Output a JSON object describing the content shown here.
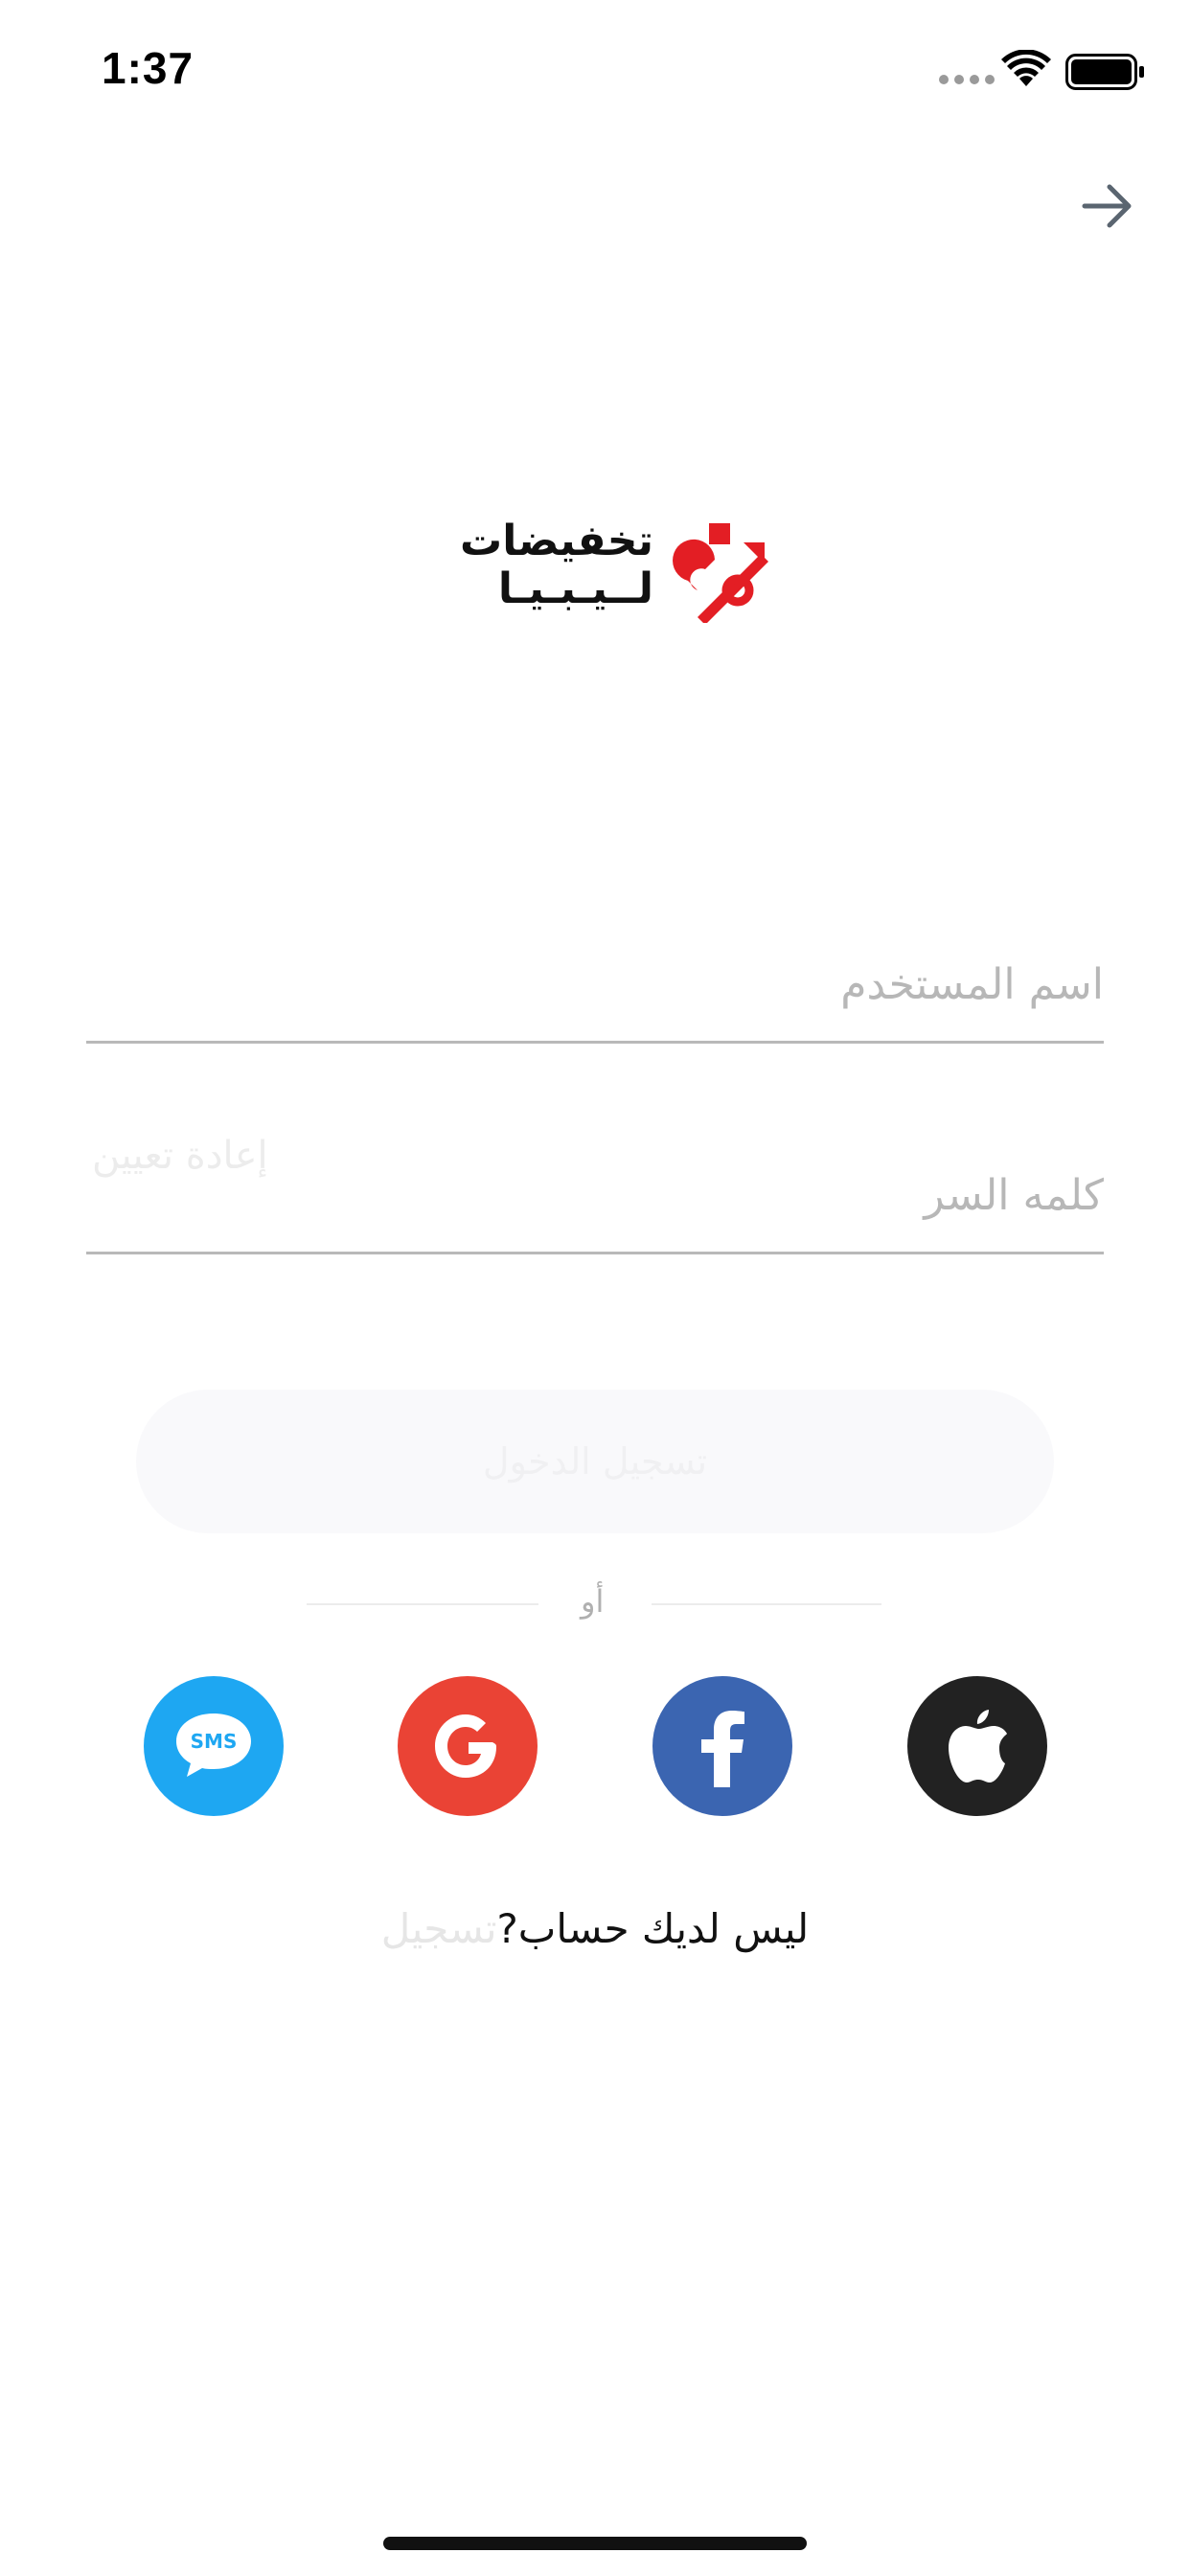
{
  "status_bar": {
    "time": "1:37"
  },
  "header": {
    "arrow_icon": "arrow-right-icon"
  },
  "logo": {
    "line1": "تخفيضات",
    "line2": "لــيـبـيـا",
    "mark_color": "#e31e24"
  },
  "form": {
    "username_placeholder": "اسم المستخدم",
    "password_placeholder": "كلمه السر",
    "reset_link": "إعادة تعيين",
    "login_button": "تسجيل الدخول"
  },
  "divider": {
    "text": "أو"
  },
  "social": [
    {
      "name": "sms",
      "label": "SMS",
      "color": "#1ea7f2",
      "icon": "sms-bubble-icon"
    },
    {
      "name": "google",
      "color": "#ea4335",
      "icon": "google-icon"
    },
    {
      "name": "facebook",
      "color": "#3b65b1",
      "icon": "facebook-icon"
    },
    {
      "name": "apple",
      "color": "#222222",
      "icon": "apple-icon"
    }
  ],
  "register": {
    "question": "ليس لديك حساب?",
    "link": "تسجيل"
  }
}
